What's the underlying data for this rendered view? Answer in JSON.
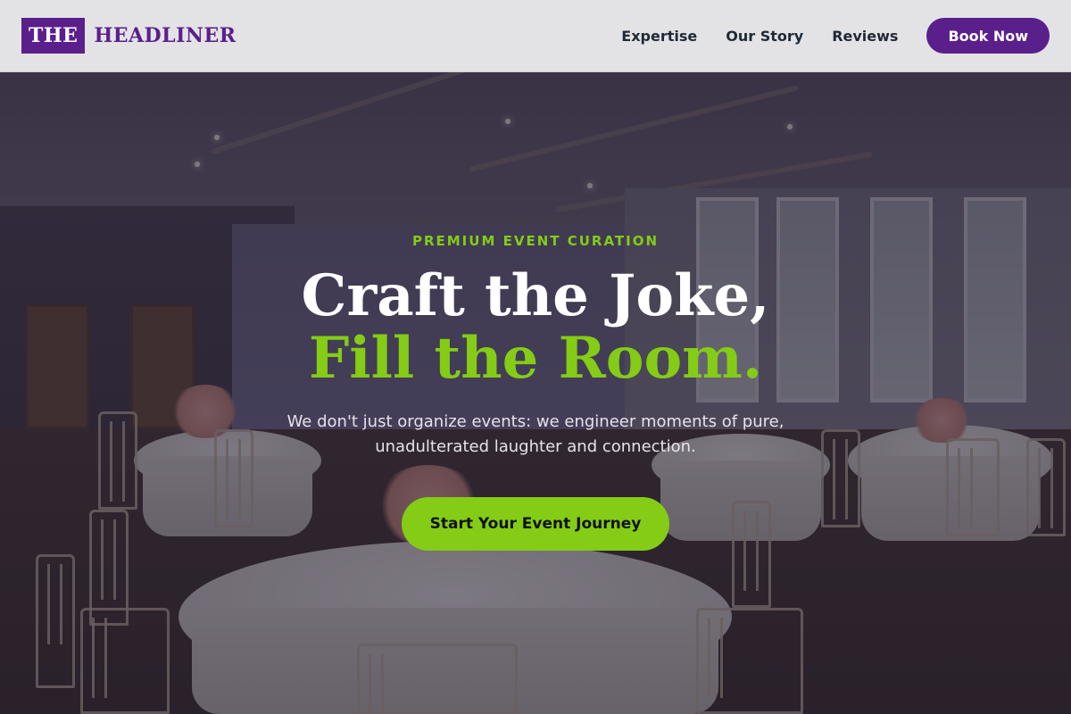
{
  "header": {
    "logo_mark": "THE",
    "logo_name": "HEADLINER",
    "nav": [
      {
        "label": "Expertise"
      },
      {
        "label": "Our Story"
      },
      {
        "label": "Reviews"
      }
    ],
    "cta_label": "Book Now"
  },
  "hero": {
    "eyebrow": "PREMIUM EVENT CURATION",
    "headline_line1": "Craft the Joke,",
    "headline_line2": "Fill the Room.",
    "subtext": "We don't just organize events: we engineer moments of pure, unadulterated laughter and connection.",
    "cta_label": "Start Your Event Journey"
  },
  "colors": {
    "brand_purple": "#5b1f8c",
    "accent_green": "#84cc16",
    "header_bg": "#e3e3e6",
    "hero_overlay": "rgba(28,22,40,0.55)"
  }
}
